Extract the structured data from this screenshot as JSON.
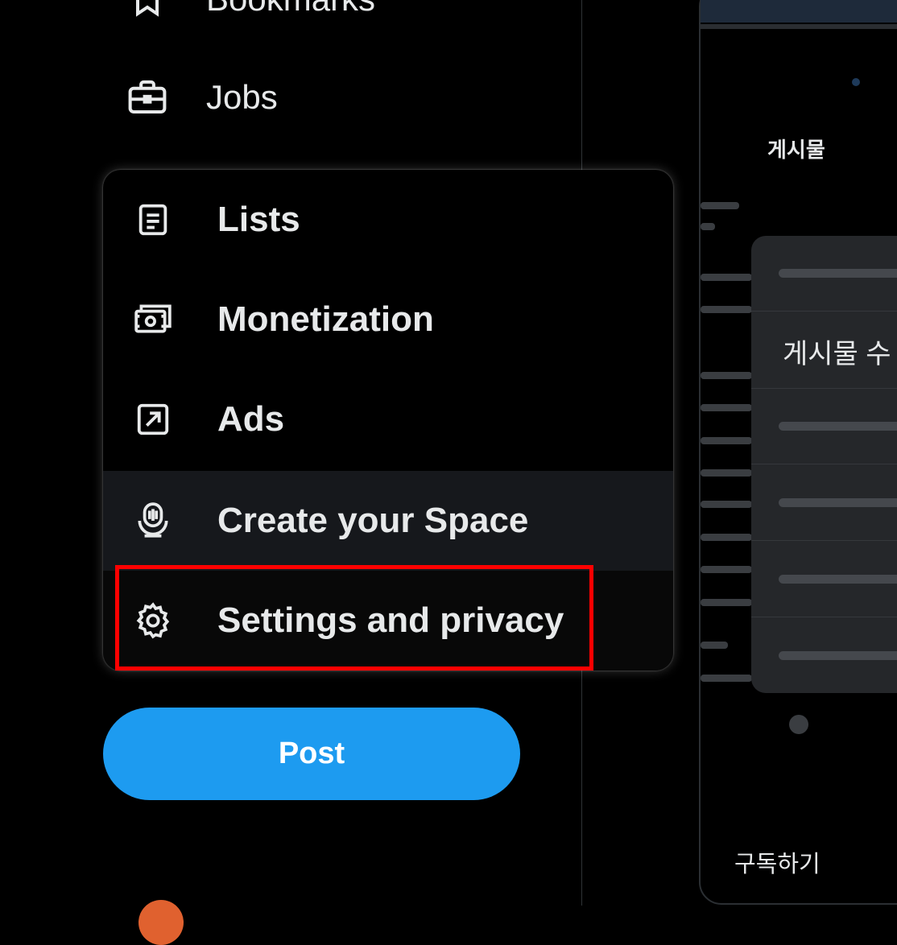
{
  "nav": {
    "bookmarks_label": "Bookmarks",
    "jobs_label": "Jobs"
  },
  "menu": {
    "items": [
      {
        "label": "Lists",
        "icon": "list-icon"
      },
      {
        "label": "Monetization",
        "icon": "money-icon"
      },
      {
        "label": "Ads",
        "icon": "ads-icon"
      },
      {
        "label": "Create your Space",
        "icon": "spaces-mic-icon"
      },
      {
        "label": "Settings and privacy",
        "icon": "gear-icon"
      }
    ]
  },
  "post_button": "Post",
  "right_panel": {
    "tab_label": "게시물",
    "card_text": "게시물 수",
    "subscribe_label": "구독하기"
  },
  "colors": {
    "accent": "#1d9bf0",
    "highlight": "#ff0000",
    "background": "#000000"
  }
}
